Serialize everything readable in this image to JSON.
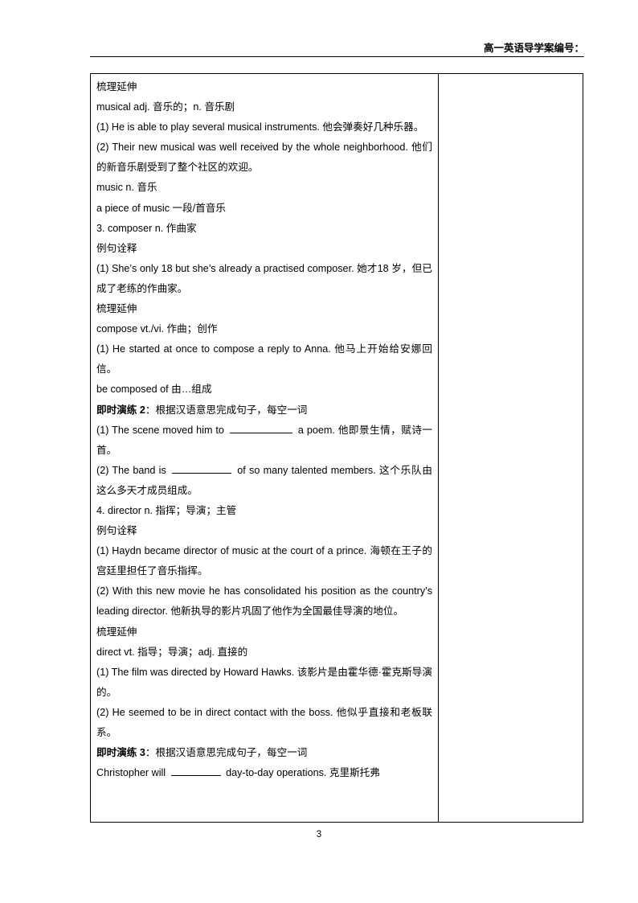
{
  "header": {
    "title": "高一英语导学案编号："
  },
  "table": {
    "lines": [
      {
        "id": "l1",
        "type": "heading",
        "text": "梳理延伸"
      },
      {
        "id": "l2",
        "type": "text",
        "text": "musical   adj. 音乐的；n. 音乐剧"
      },
      {
        "id": "l3",
        "type": "text",
        "text": "(1) He is able to play several musical instruments. 他会弹奏好几种乐器。"
      },
      {
        "id": "l4",
        "type": "text",
        "text": "(2) Their new musical was well received by the whole neighborhood. 他们的新音乐剧受到了整个社区的欢迎。"
      },
      {
        "id": "l5",
        "type": "text",
        "text": "music   n. 音乐"
      },
      {
        "id": "l6",
        "type": "text",
        "text": "a piece of music 一段/首音乐"
      },
      {
        "id": "l7",
        "type": "text",
        "text": "3. composer   n. 作曲家"
      },
      {
        "id": "l8",
        "type": "heading",
        "text": "例句诠释"
      },
      {
        "id": "l9",
        "type": "text",
        "text": "(1) She’s only 18 but she’s already a practised composer. 她才18 岁，但已成了老练的作曲家。"
      },
      {
        "id": "l10",
        "type": "heading",
        "text": "梳理延伸"
      },
      {
        "id": "l11",
        "type": "text",
        "text": "compose   vt./vi. 作曲；创作"
      },
      {
        "id": "l12",
        "type": "text",
        "text": "(1) He started at once to compose a reply to Anna. 他马上开始给安娜回信。"
      },
      {
        "id": "l13",
        "type": "text",
        "text": "be composed of 由…组成"
      },
      {
        "id": "l14",
        "type": "exercise-heading",
        "label": "即时演练 2",
        "text": "：根据汉语意思完成句子，每空一词"
      },
      {
        "id": "l15",
        "type": "blank-line",
        "before": "(1) The scene moved him to ",
        "blank": "blank-10",
        "after": " a poem. 他即景生情，赋诗一首。"
      },
      {
        "id": "l16",
        "type": "blank-line",
        "before": "(2) The band is ",
        "blank": "blank-9",
        "after": " of so many talented members. 这个乐队由这么多天才成员组成。"
      },
      {
        "id": "l17",
        "type": "text",
        "text": "4. director   n. 指挥；导演；主管"
      },
      {
        "id": "l18",
        "type": "heading",
        "text": "例句诠释"
      },
      {
        "id": "l19",
        "type": "text",
        "text": "(1) Haydn became director of music at the court of a prince. 海顿在王子的宫廷里担任了音乐指挥。"
      },
      {
        "id": "l20",
        "type": "text",
        "text": "(2) With this new movie he has consolidated his position as the country’s leading director. 他新执导的影片巩固了他作为全国最佳导演的地位。"
      },
      {
        "id": "l21",
        "type": "heading",
        "text": "梳理延伸"
      },
      {
        "id": "l22",
        "type": "text",
        "text": "direct   vt. 指导；导演；adj. 直接的"
      },
      {
        "id": "l23",
        "type": "text",
        "text": "(1) The film was directed by Howard Hawks. 该影片是由霍华德·霍克斯导演的。"
      },
      {
        "id": "l24",
        "type": "text",
        "text": "(2) He seemed to be in direct contact with the boss. 他似乎直接和老板联系。"
      },
      {
        "id": "l25",
        "type": "exercise-heading",
        "label": "即时演练 3",
        "text": "：根据汉语意思完成句子，每空一词"
      },
      {
        "id": "l26",
        "type": "blank-line",
        "before": "Christopher will ",
        "blank": "blank-8",
        "after": " day-to-day operations. 克里斯托弗"
      }
    ]
  },
  "footer": {
    "page_number": "3"
  }
}
